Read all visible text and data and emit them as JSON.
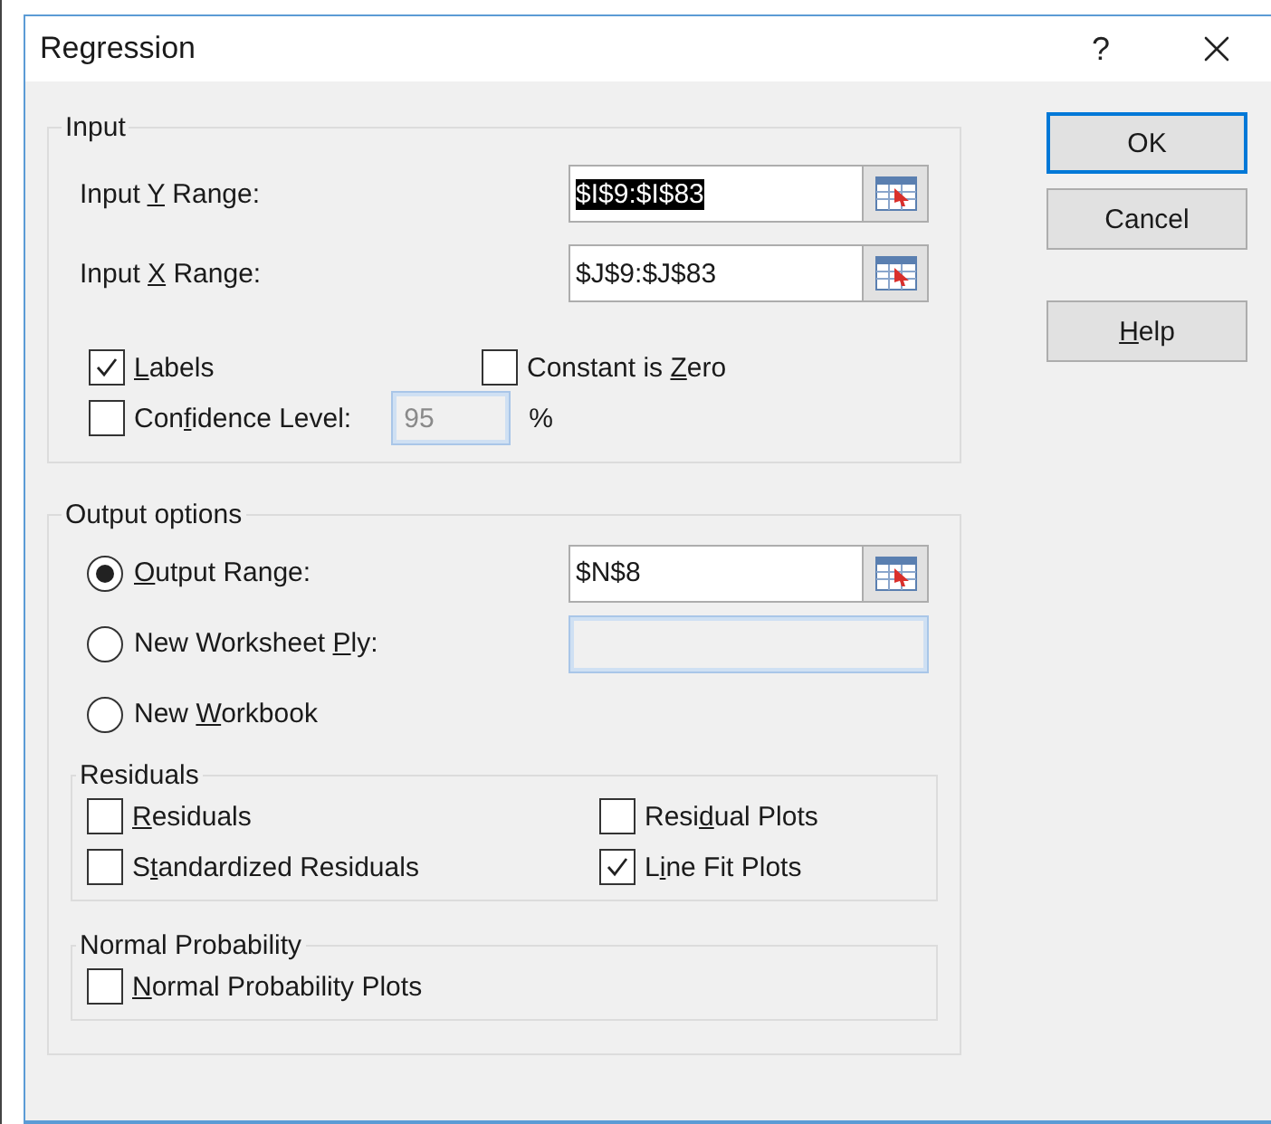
{
  "window": {
    "title": "Regression",
    "help_glyph": "?"
  },
  "input": {
    "legend": "Input",
    "ranges": [
      {
        "label": {
          "before": "Input ",
          "key": "Y",
          "after": " Range:"
        },
        "value": "$I$9:$I$83",
        "highlighted": true
      },
      {
        "label": {
          "before": "Input ",
          "key": "X",
          "after": " Range:"
        },
        "value": "$J$9:$J$83",
        "highlighted": false
      }
    ],
    "checks": [
      {
        "label": {
          "key": "L",
          "after": "abels"
        },
        "checked": true
      },
      {
        "label": {
          "before": "Constant is ",
          "key": "Z",
          "after": "ero"
        },
        "checked": false
      }
    ],
    "confidence": {
      "label": {
        "before": "Con",
        "key": "f",
        "after": "idence Level:"
      },
      "checked": false,
      "value": "95",
      "unit": "%",
      "disabled": true
    }
  },
  "output": {
    "legend": "Output options",
    "destinations": [
      {
        "label": {
          "key": "O",
          "after": "utput Range:"
        },
        "selected": true,
        "field": {
          "value": "$N$8",
          "disabled": false
        }
      },
      {
        "label": {
          "before": "New Worksheet ",
          "key": "P",
          "after": "ly:"
        },
        "selected": false,
        "field": {
          "disabled": true
        }
      },
      {
        "label": {
          "before": "New ",
          "key": "W",
          "after": "orkbook"
        },
        "selected": false
      }
    ],
    "residuals": {
      "legend": "Residuals",
      "options": [
        {
          "label": {
            "key": "R",
            "after": "esiduals"
          },
          "checked": false
        },
        {
          "label": {
            "before": "Resi",
            "key": "d",
            "after": "ual Plots"
          },
          "checked": false
        },
        {
          "label": {
            "before": "S",
            "key": "t",
            "after": "andardized Residuals"
          },
          "checked": false
        },
        {
          "label": {
            "before": "L",
            "key": "i",
            "after": "ne Fit Plots"
          },
          "checked": true
        }
      ]
    },
    "normal_probability": {
      "legend": "Normal Probability",
      "options": [
        {
          "label": {
            "key": "N",
            "after": "ormal Probability Plots"
          },
          "checked": false
        }
      ]
    }
  },
  "buttons": [
    {
      "label": {
        "after": "OK"
      },
      "default": true
    },
    {
      "label": {
        "after": "Cancel"
      },
      "default": false
    },
    {
      "label": {
        "key": "H",
        "after": "elp"
      },
      "default": false
    }
  ]
}
